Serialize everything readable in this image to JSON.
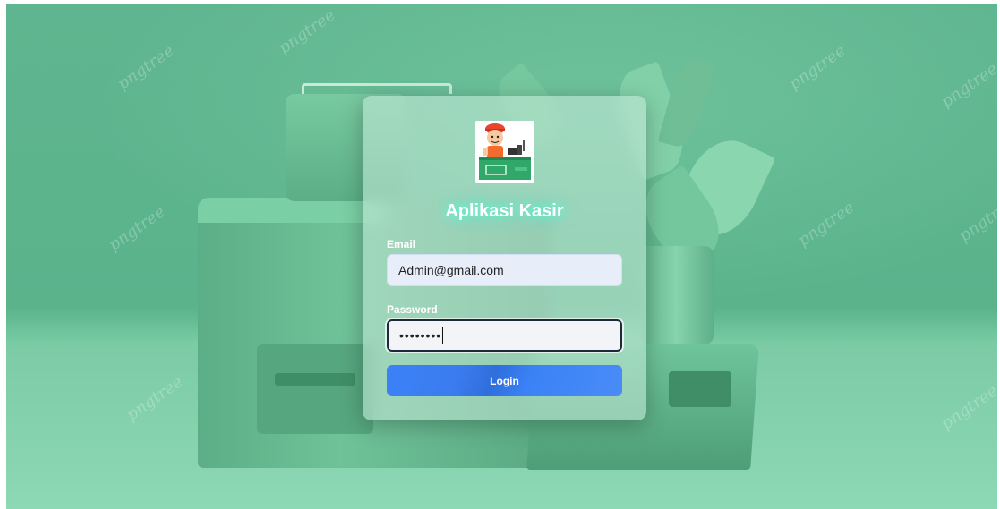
{
  "app": {
    "title": "Aplikasi Kasir"
  },
  "form": {
    "email_label": "Email",
    "email_value": "Admin@gmail.com",
    "password_label": "Password",
    "password_masked": "••••••••",
    "login_label": "Login"
  },
  "background": {
    "watermark": "pngtree"
  },
  "colors": {
    "accent": "#3b82f6",
    "background": "#5ab38b",
    "title_glow": "#50ffdc"
  },
  "icons": {
    "logo": "cashier-logo"
  }
}
